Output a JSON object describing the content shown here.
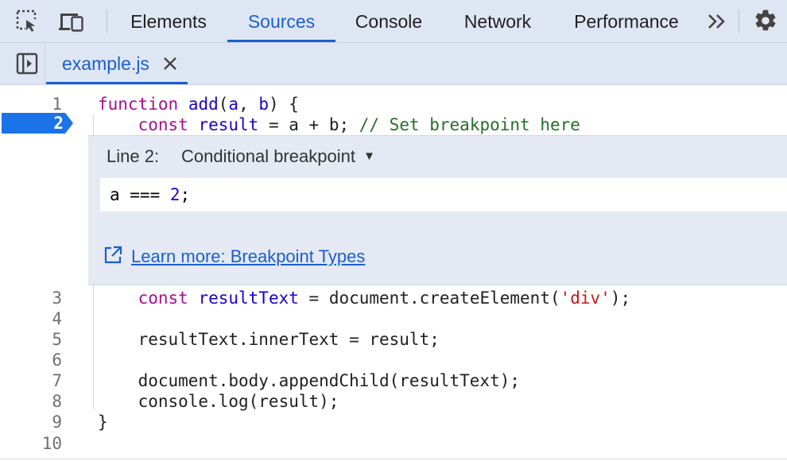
{
  "devtools": {
    "tabs": [
      "Elements",
      "Sources",
      "Console",
      "Network",
      "Performance"
    ],
    "active_tab": "Sources",
    "more_tabs_label": "»",
    "icons": {
      "inspect": "inspect-element-icon",
      "device": "device-toolbar-icon",
      "settings": "gear-icon",
      "navigator": "sidebar-toggle-icon",
      "close": "close-icon",
      "external": "external-link-icon"
    },
    "accent_color": "#1a5fd1"
  },
  "editor": {
    "file_name": "example.js",
    "lines": [
      {
        "n": "1",
        "parts": [
          [
            "kw",
            "function"
          ],
          [
            "",
            "",
            " "
          ],
          [
            "fn",
            "add"
          ],
          [
            "",
            "("
          ],
          [
            "vr",
            "a"
          ],
          [
            "",
            ", "
          ],
          [
            "vr",
            "b"
          ],
          [
            "",
            ") {"
          ]
        ]
      },
      {
        "n": "2",
        "parts": [
          [
            "",
            "    "
          ],
          [
            "kw",
            "const"
          ],
          [
            "",
            "",
            " "
          ],
          [
            "vr",
            "result"
          ],
          [
            "",
            "",
            " = a + b; "
          ],
          [
            "cm",
            "// Set breakpoint here"
          ]
        ]
      },
      {
        "n": "3",
        "parts": [
          [
            "",
            "    "
          ],
          [
            "kw",
            "const"
          ],
          [
            "",
            "",
            " "
          ],
          [
            "vr",
            "resultText"
          ],
          [
            "",
            "",
            " = document.createElement("
          ],
          [
            "str",
            "'div'"
          ],
          [
            "",
            ");"
          ]
        ]
      },
      {
        "n": "4",
        "parts": []
      },
      {
        "n": "5",
        "parts": [
          [
            "",
            "    resultText.innerText = result;"
          ]
        ]
      },
      {
        "n": "6",
        "parts": []
      },
      {
        "n": "7",
        "parts": [
          [
            "",
            "    document.body.appendChild(resultText);"
          ]
        ]
      },
      {
        "n": "8",
        "parts": [
          [
            "",
            "    console.log(result);"
          ]
        ]
      },
      {
        "n": "9",
        "parts": [
          [
            "",
            "}"
          ]
        ]
      },
      {
        "n": "10",
        "parts": []
      }
    ]
  },
  "breakpoint": {
    "line_label": "Line 2:",
    "type_label": "Conditional breakpoint",
    "dropdown_arrow": "▼",
    "condition_plain": "a === ",
    "condition_number": "2",
    "condition_end": ";",
    "learn_more": "Learn more: Breakpoint Types",
    "line_number": "2",
    "marker_color": "#1a73e8"
  }
}
